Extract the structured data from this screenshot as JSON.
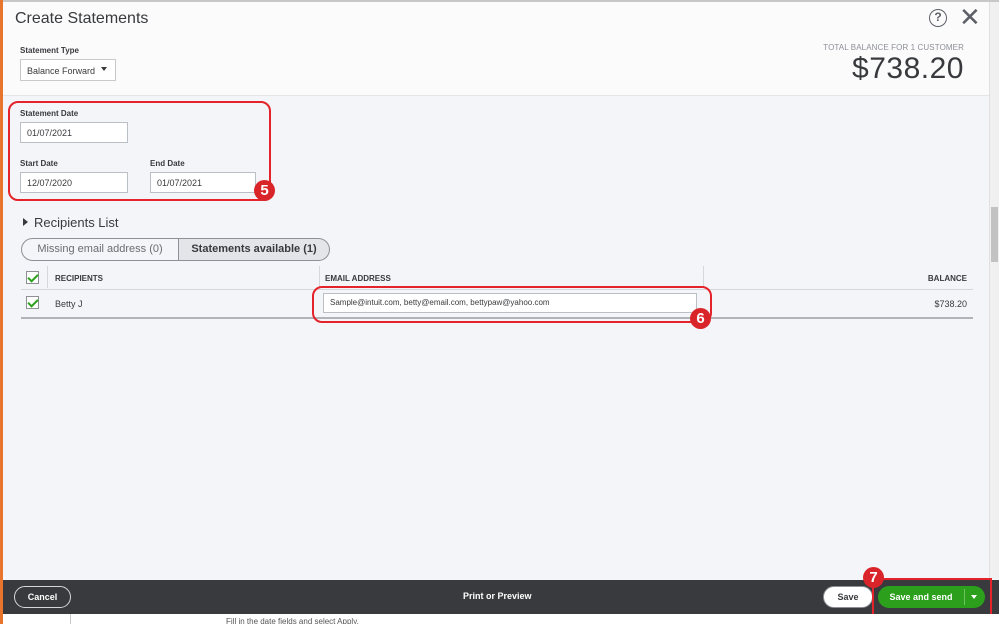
{
  "window": {
    "title": "Create Statements"
  },
  "header": {
    "statement_type_label": "Statement Type",
    "statement_type_value": "Balance Forward",
    "total_label": "TOTAL BALANCE FOR 1 CUSTOMER",
    "total_amount": "$738.20"
  },
  "dates": {
    "statement_date_label": "Statement Date",
    "statement_date_value": "01/07/2021",
    "start_date_label": "Start Date",
    "start_date_value": "12/07/2020",
    "end_date_label": "End Date",
    "end_date_value": "01/07/2021"
  },
  "recipients": {
    "section_label": "Recipients List",
    "tabs": [
      {
        "label": "Missing email address (0)",
        "selected": false
      },
      {
        "label": "Statements available (1)",
        "selected": true
      }
    ],
    "columns": [
      "RECIPIENTS",
      "EMAIL ADDRESS",
      "BALANCE"
    ],
    "rows": [
      {
        "checked": true,
        "name": "Betty J",
        "email": "Sample@intuit.com, betty@email.com, bettypaw@yahoo.com",
        "balance": "$738.20"
      }
    ]
  },
  "callouts": [
    "5",
    "6",
    "7"
  ],
  "footer": {
    "cancel_label": "Cancel",
    "print_label": "Print or Preview",
    "save_label": "Save",
    "save_send_label": "Save and send"
  },
  "below_text": "Fill in the date fields and select Apply.",
  "colors": {
    "accent_green": "#2ca01c",
    "footer_bg": "#393a3d",
    "annotation_red": "#e4232a"
  }
}
